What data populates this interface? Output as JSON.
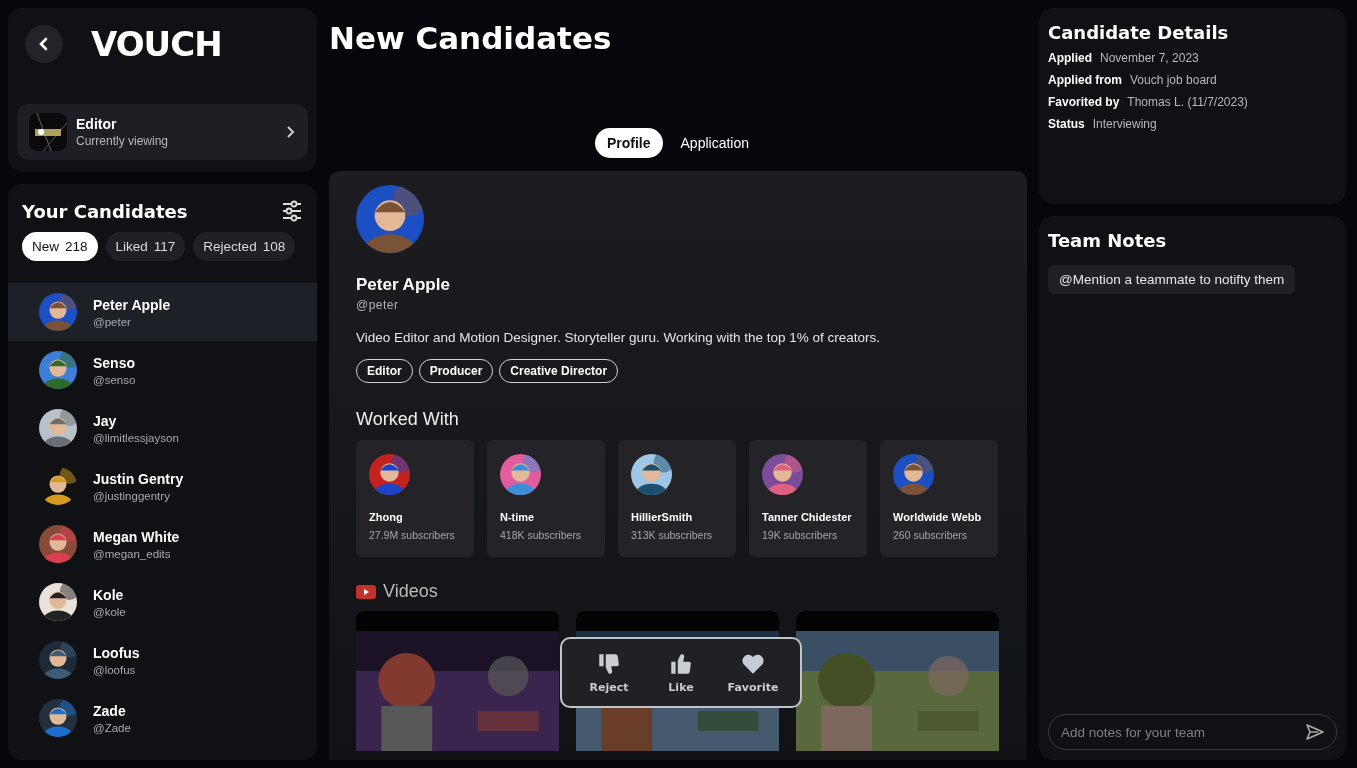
{
  "header": {
    "logo": "VOUCH",
    "title": "New Candidates"
  },
  "workspace": {
    "name": "Editor",
    "subtitle": "Currently viewing"
  },
  "candidates_panel": {
    "title": "Your Candidates",
    "filters": [
      {
        "label": "New",
        "count": "218",
        "selected": true
      },
      {
        "label": "Liked",
        "count": "117",
        "selected": false
      },
      {
        "label": "Rejected",
        "count": "108",
        "selected": false
      }
    ],
    "candidates": [
      {
        "name": "Peter Apple",
        "handle": "@peter",
        "selected": true
      },
      {
        "name": "Senso",
        "handle": "@senso",
        "selected": false
      },
      {
        "name": "Jay",
        "handle": "@limitlessjayson",
        "selected": false
      },
      {
        "name": "Justin Gentry",
        "handle": "@justinggentry",
        "selected": false
      },
      {
        "name": "Megan White",
        "handle": "@megan_edits",
        "selected": false
      },
      {
        "name": "Kole",
        "handle": "@kole",
        "selected": false
      },
      {
        "name": "Loofus",
        "handle": "@loofus",
        "selected": false
      },
      {
        "name": "Zade",
        "handle": "@Zade",
        "selected": false
      }
    ]
  },
  "tabs": [
    {
      "label": "Profile",
      "selected": true
    },
    {
      "label": "Application",
      "selected": false
    }
  ],
  "profile": {
    "name": "Peter Apple",
    "handle": "@peter",
    "bio": "Video Editor and Motion Designer. Storyteller guru. Working with the top 1% of creators.",
    "tags": [
      "Editor",
      "Producer",
      "Creative Director"
    ],
    "worked_with_title": "Worked With",
    "worked_with": [
      {
        "name": "Zhong",
        "subscribers": "27.9M subscribers"
      },
      {
        "name": "N-time",
        "subscribers": "418K subscribers"
      },
      {
        "name": "HillierSmith",
        "subscribers": "313K subscribers"
      },
      {
        "name": "Tanner Chidester",
        "subscribers": "19K subscribers"
      },
      {
        "name": "Worldwide Webb",
        "subscribers": "260 subscribers"
      }
    ],
    "videos_title": "Videos"
  },
  "actions": [
    {
      "kind": "reject",
      "label": "Reject"
    },
    {
      "kind": "like",
      "label": "Like"
    },
    {
      "kind": "favorite",
      "label": "Favorite"
    }
  ],
  "details": {
    "title": "Candidate Details",
    "fields": [
      {
        "label": "Applied",
        "value": "November 7, 2023"
      },
      {
        "label": "Applied from",
        "value": "Vouch job board"
      },
      {
        "label": "Favorited by",
        "value": "Thomas L. (11/7/2023)"
      },
      {
        "label": "Status",
        "value": "Interviewing"
      }
    ]
  },
  "team_notes": {
    "title": "Team Notes",
    "hint": "@Mention a teammate to notifty them",
    "placeholder": "Add notes for your team"
  }
}
